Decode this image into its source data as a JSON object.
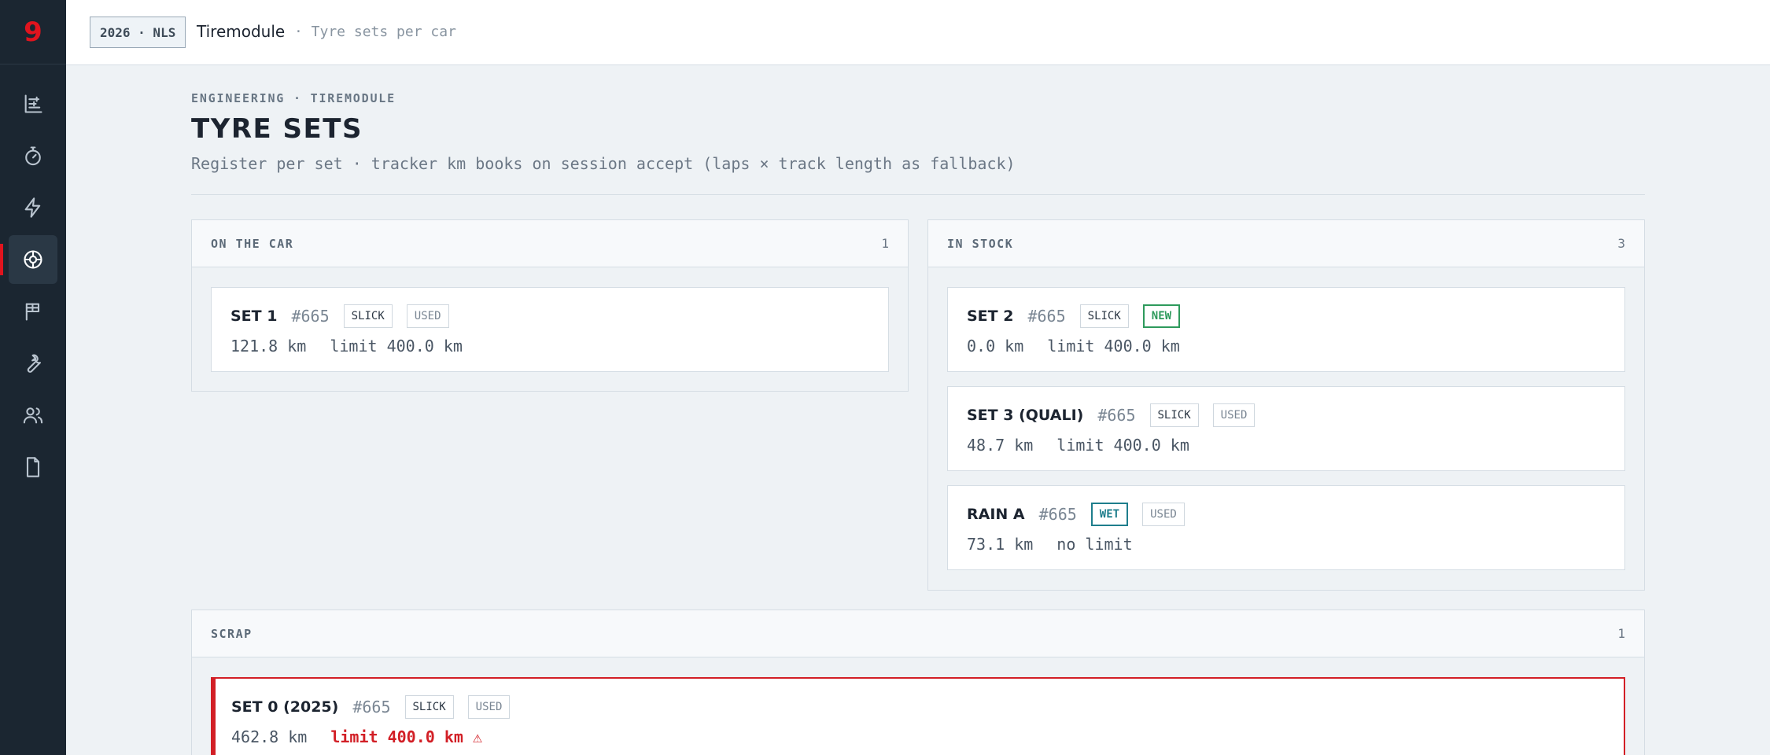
{
  "app": {
    "logo": "9"
  },
  "sidebar": {
    "items": [
      {
        "icon": "timeline-icon"
      },
      {
        "icon": "stopwatch-icon"
      },
      {
        "icon": "lightning-icon"
      },
      {
        "icon": "tyre-icon",
        "active": true
      },
      {
        "icon": "flag-icon"
      },
      {
        "icon": "wrench-icon"
      },
      {
        "icon": "users-icon"
      },
      {
        "icon": "document-icon"
      }
    ]
  },
  "topbar": {
    "season": "2026 · NLS",
    "module": "Tiremodule",
    "subtitle": "· Tyre sets per car"
  },
  "header": {
    "eyebrow": "ENGINEERING · TIREMODULE",
    "title": "TYRE SETS",
    "description": "Register per set · tracker km books on session accept (laps × track length as fallback)"
  },
  "panels": {
    "on_car": {
      "title": "ON THE CAR",
      "count": "1",
      "cards": [
        {
          "name": "SET 1",
          "number": "#665",
          "compound": "SLICK",
          "condition": "USED",
          "km": "121.8 km",
          "limit": "limit 400.0 km"
        }
      ]
    },
    "in_stock": {
      "title": "IN STOCK",
      "count": "3",
      "cards": [
        {
          "name": "SET 2",
          "number": "#665",
          "compound": "SLICK",
          "condition": "NEW",
          "km": "0.0 km",
          "limit": "limit 400.0 km"
        },
        {
          "name": "SET 3 (QUALI)",
          "number": "#665",
          "compound": "SLICK",
          "condition": "USED",
          "km": "48.7 km",
          "limit": "limit 400.0 km"
        },
        {
          "name": "RAIN A",
          "number": "#665",
          "compound": "WET",
          "condition": "USED",
          "km": "73.1 km",
          "limit": "no limit"
        }
      ]
    },
    "scrap": {
      "title": "SCRAP",
      "count": "1",
      "cards": [
        {
          "name": "SET 0 (2025)",
          "number": "#665",
          "compound": "SLICK",
          "condition": "USED",
          "km": "462.8 km",
          "limit": "limit 400.0 km ⚠",
          "over_limit": true
        }
      ]
    }
  },
  "colors": {
    "brand": "#e0141e",
    "sidebar": "#1b2631",
    "new_tag": "#2e9a5c",
    "wet_tag": "#1e7e8c",
    "danger": "#d21f26"
  }
}
